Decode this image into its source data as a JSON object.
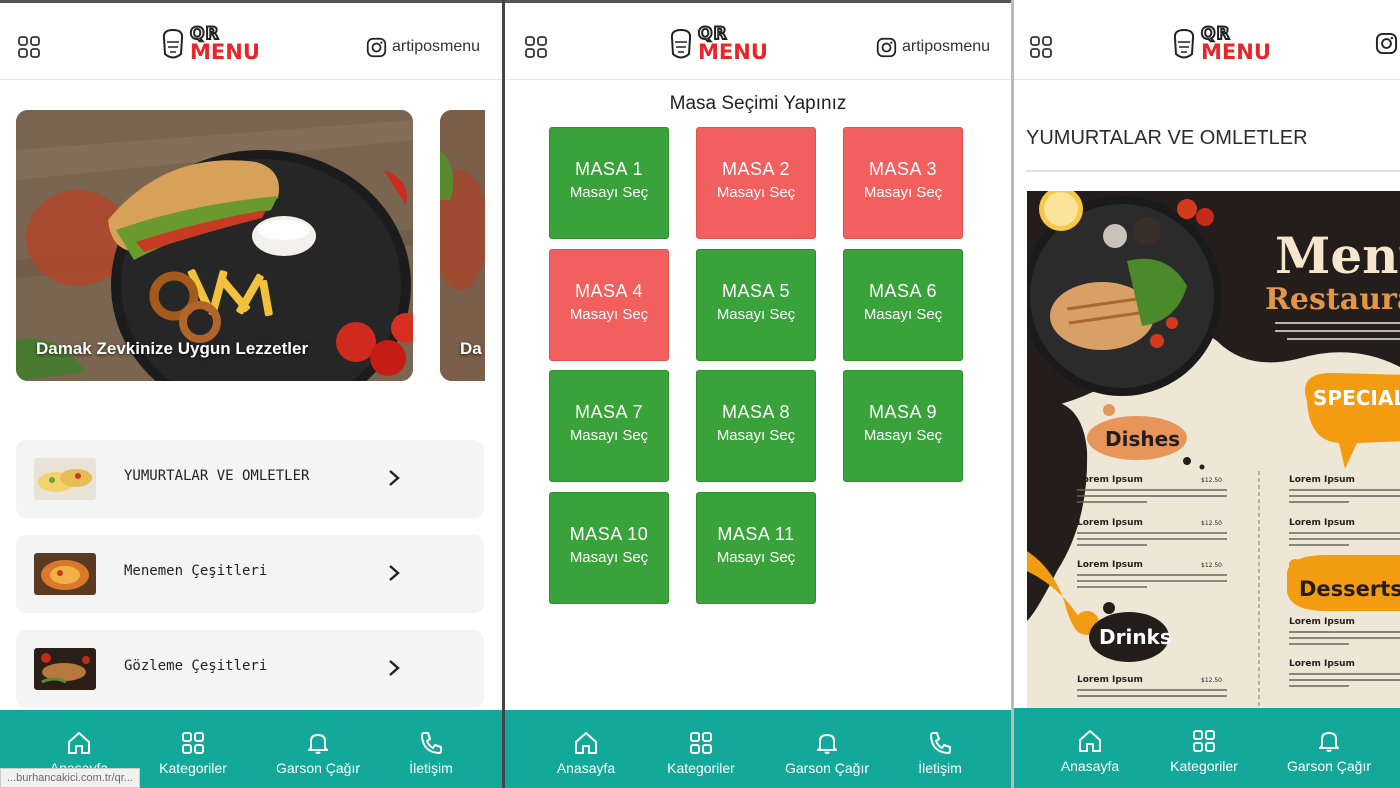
{
  "header": {
    "logo_top": "QR",
    "logo_bottom": "MENU",
    "instagram_handle": "artiposmenu"
  },
  "home": {
    "slider": {
      "caption": "Damak Zevkinize Uygun Lezzetler",
      "next_caption_fragment": "Da"
    },
    "categories": [
      {
        "label": "YUMURTALAR VE OMLETLER",
        "thumb": "omelette-thumb"
      },
      {
        "label": "Menemen Çeşitleri",
        "thumb": "menemen-thumb"
      },
      {
        "label": "Gözleme Çeşitleri",
        "thumb": "gozleme-thumb"
      }
    ]
  },
  "table_select": {
    "title": "Masa Seçimi Yapınız",
    "action_label": "Masayı Seç",
    "tables": [
      {
        "name": "MASA 1",
        "status": "available"
      },
      {
        "name": "MASA 2",
        "status": "occupied"
      },
      {
        "name": "MASA 3",
        "status": "occupied"
      },
      {
        "name": "MASA 4",
        "status": "occupied"
      },
      {
        "name": "MASA 5",
        "status": "available"
      },
      {
        "name": "MASA 6",
        "status": "available"
      },
      {
        "name": "MASA 7",
        "status": "available"
      },
      {
        "name": "MASA 8",
        "status": "available"
      },
      {
        "name": "MASA 9",
        "status": "available"
      },
      {
        "name": "MASA 10",
        "status": "available"
      },
      {
        "name": "MASA 11",
        "status": "available"
      }
    ]
  },
  "category_page": {
    "heading": "YUMURTALAR VE OMLETLER",
    "poster": {
      "title_1": "Menu",
      "title_2": "Restaurant",
      "badge": "SPECIAL MENU",
      "dishes": "Dishes",
      "drinks": "Drinks",
      "desserts": "Desserts",
      "item_name": "Lorem Ipsum",
      "item_price": "$12.50"
    }
  },
  "nav": {
    "items": [
      {
        "label": "Anasayfa",
        "icon": "home-icon"
      },
      {
        "label": "Kategoriler",
        "icon": "grid-icon"
      },
      {
        "label": "Garson Çağır",
        "icon": "bell-icon"
      },
      {
        "label": "İletişim",
        "icon": "phone-icon"
      }
    ]
  },
  "status_url": "...burhancakici.com.tr/qr...",
  "colors": {
    "available": "#3aa23a",
    "occupied": "#f15f5e",
    "nav_bg": "#13a99a",
    "logo_red": "#e8262a"
  }
}
